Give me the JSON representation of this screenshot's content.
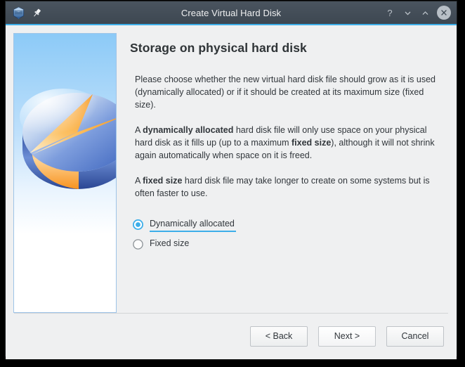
{
  "window": {
    "title": "Create Virtual Hard Disk",
    "icons": {
      "app": "virtualbox-cube-icon",
      "pin": "pin-icon",
      "help": "?",
      "minimize": "chevron-down-icon",
      "maximize": "chevron-up-icon",
      "close": "close-icon"
    }
  },
  "page": {
    "title": "Storage on physical hard disk",
    "paragraphs": [
      {
        "id": "intro",
        "runs": [
          {
            "text": "Please choose whether the new virtual hard disk file should grow as it is used (dynamically allocated) or if it should be created at its maximum size (fixed size).",
            "bold": false
          }
        ]
      },
      {
        "id": "dynamic-explain",
        "runs": [
          {
            "text": "A ",
            "bold": false
          },
          {
            "text": "dynamically allocated",
            "bold": true
          },
          {
            "text": " hard disk file will only use space on your physical hard disk as it fills up (up to a maximum ",
            "bold": false
          },
          {
            "text": "fixed size",
            "bold": true
          },
          {
            "text": "), although it will not shrink again automatically when space on it is freed.",
            "bold": false
          }
        ]
      },
      {
        "id": "fixed-explain",
        "runs": [
          {
            "text": "A ",
            "bold": false
          },
          {
            "text": "fixed size",
            "bold": true
          },
          {
            "text": " hard disk file may take longer to create on some systems but is often faster to use.",
            "bold": false
          }
        ]
      }
    ]
  },
  "options": {
    "name": "storage-type",
    "items": [
      {
        "id": "dynamically-allocated",
        "label": "Dynamically allocated",
        "selected": true,
        "focused": true
      },
      {
        "id": "fixed-size",
        "label": "Fixed size",
        "selected": false,
        "focused": false
      }
    ]
  },
  "footer": {
    "buttons": [
      {
        "id": "back",
        "label": "< Back",
        "default": false
      },
      {
        "id": "next",
        "label": "Next >",
        "default": true
      },
      {
        "id": "cancel",
        "label": "Cancel",
        "default": false
      }
    ]
  },
  "colors": {
    "titlebar": "#3d4751",
    "accent": "#3daee9",
    "window_bg": "#eff0f1",
    "text": "#31363b",
    "heading": "#2f3437",
    "watermark_sky": "#8ccaf7",
    "watermark_disk_blue": "#4a74c8",
    "watermark_slice_orange": "#f9a02b"
  }
}
